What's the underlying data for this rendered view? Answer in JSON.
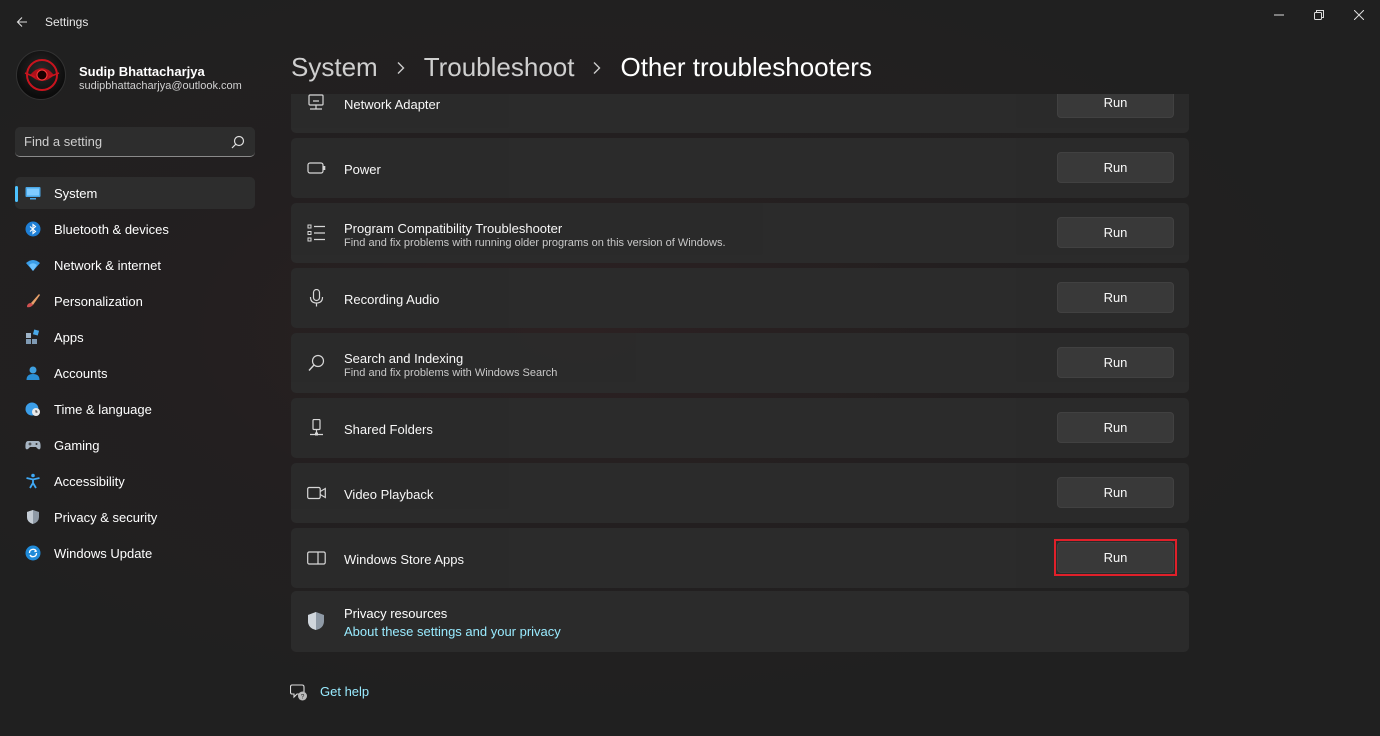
{
  "window": {
    "title": "Settings",
    "controls": [
      "minimize",
      "restore",
      "close"
    ]
  },
  "profile": {
    "name": "Sudip Bhattacharjya",
    "email": "sudipbhattacharjya@outlook.com",
    "avatar_text": "GIGABYTE TECHNOLOGY"
  },
  "search": {
    "placeholder": "Find a setting"
  },
  "sidebar": {
    "items": [
      {
        "label": "System",
        "icon": "system-icon",
        "active": true
      },
      {
        "label": "Bluetooth & devices",
        "icon": "bluetooth-icon"
      },
      {
        "label": "Network & internet",
        "icon": "wifi-icon"
      },
      {
        "label": "Personalization",
        "icon": "brush-icon"
      },
      {
        "label": "Apps",
        "icon": "apps-icon"
      },
      {
        "label": "Accounts",
        "icon": "person-icon"
      },
      {
        "label": "Time & language",
        "icon": "globe-clock-icon"
      },
      {
        "label": "Gaming",
        "icon": "gamepad-icon"
      },
      {
        "label": "Accessibility",
        "icon": "accessibility-icon"
      },
      {
        "label": "Privacy & security",
        "icon": "shield-icon"
      },
      {
        "label": "Windows Update",
        "icon": "update-icon"
      }
    ]
  },
  "breadcrumb": {
    "items": [
      "System",
      "Troubleshoot",
      "Other troubleshooters"
    ]
  },
  "troubleshooters": [
    {
      "title": "Network Adapter",
      "desc": "",
      "icon": "network-adapter-icon",
      "button": "Run"
    },
    {
      "title": "Power",
      "desc": "",
      "icon": "battery-icon",
      "button": "Run"
    },
    {
      "title": "Program Compatibility Troubleshooter",
      "desc": "Find and fix problems with running older programs on this version of Windows.",
      "icon": "list-icon",
      "button": "Run"
    },
    {
      "title": "Recording Audio",
      "desc": "",
      "icon": "microphone-icon",
      "button": "Run"
    },
    {
      "title": "Search and Indexing",
      "desc": "Find and fix problems with Windows Search",
      "icon": "search-icon",
      "button": "Run"
    },
    {
      "title": "Shared Folders",
      "desc": "",
      "icon": "shared-folder-icon",
      "button": "Run"
    },
    {
      "title": "Video Playback",
      "desc": "",
      "icon": "video-camera-icon",
      "button": "Run"
    },
    {
      "title": "Windows Store Apps",
      "desc": "",
      "icon": "store-apps-icon",
      "button": "Run",
      "highlighted": true
    }
  ],
  "privacy": {
    "title": "Privacy resources",
    "link": "About these settings and your privacy",
    "icon": "shield-icon"
  },
  "help": {
    "label": "Get help",
    "icon": "help-chat-icon"
  },
  "colors": {
    "background": "#202020",
    "card": "#2b2b2b",
    "accent": "#4cc2ff",
    "link": "#99ebff",
    "highlight": "#e0202a"
  }
}
